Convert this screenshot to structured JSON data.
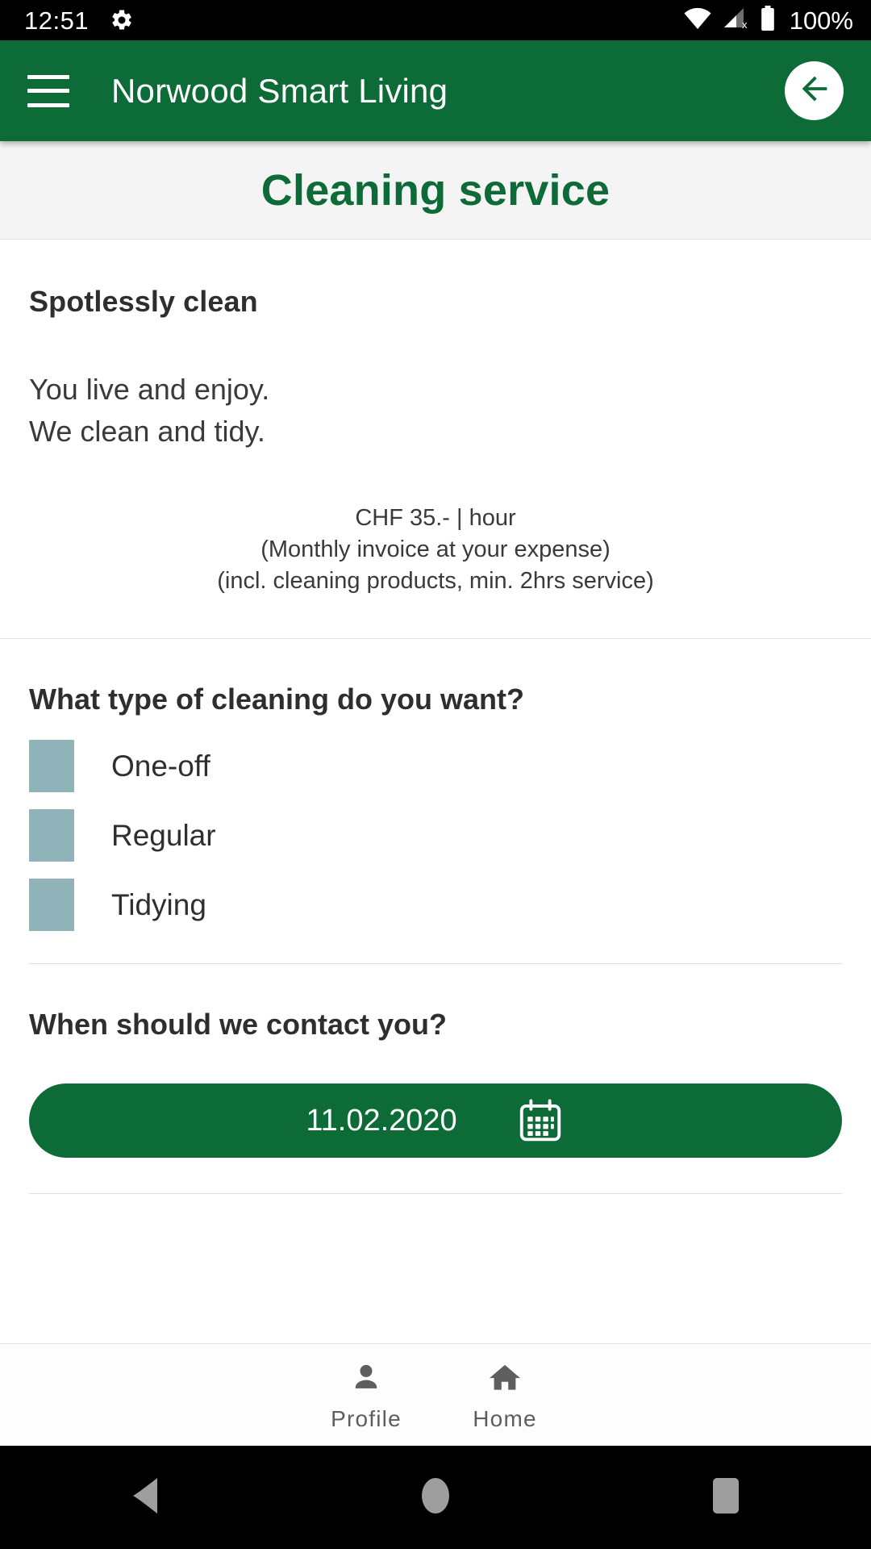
{
  "status_bar": {
    "time": "12:51",
    "battery_percent": "100%",
    "icons": [
      "settings-gear-icon",
      "wifi-icon",
      "cell-signal-off-icon",
      "battery-full-icon"
    ]
  },
  "app_bar": {
    "menu_icon": "hamburger-menu-icon",
    "title": "Norwood Smart Living",
    "back_icon": "back-arrow-icon",
    "background_color": "#0D6B38"
  },
  "page": {
    "title": "Cleaning service",
    "title_color": "#0D6B38",
    "title_band_color": "#F4F4F4"
  },
  "intro": {
    "heading": "Spotlessly clean",
    "line1": "You live and enjoy.",
    "line2": "We clean and tidy."
  },
  "pricing": {
    "line1": "CHF 35.- | hour",
    "line2": "(Monthly invoice at your expense)",
    "line3": "(incl. cleaning products, min. 2hrs service)"
  },
  "cleaning_type": {
    "question": "What type of cleaning do you want?",
    "checkbox_color": "#8FB3B9",
    "options": [
      {
        "label": "One-off",
        "checked": false
      },
      {
        "label": "Regular",
        "checked": false
      },
      {
        "label": "Tidying",
        "checked": false
      }
    ]
  },
  "contact": {
    "question": "When should we contact you?",
    "date_value": "11.02.2020",
    "date_icon": "calendar-icon",
    "button_color": "#0D6B38"
  },
  "tab_bar": {
    "tabs": [
      {
        "label": "Profile",
        "icon": "person-icon"
      },
      {
        "label": "Home",
        "icon": "house-icon"
      }
    ]
  },
  "nav_bar": {
    "back": "triangle-back-icon",
    "home": "circle-home-icon",
    "recents": "square-recents-icon"
  }
}
